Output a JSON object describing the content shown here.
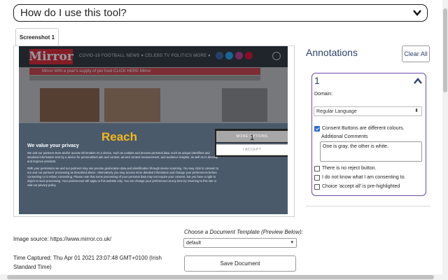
{
  "help": {
    "title": "How do I use this tool?",
    "icon": "chevron-down-icon"
  },
  "tabs": [
    {
      "label": "Screenshot 1"
    }
  ],
  "screenshot": {
    "site_logo": "Mirror",
    "nav": "COVID-19   FOOTBALL   NEWS ▾   CELEBS   TV   POLITICS   MORE ▾",
    "ad_text": "Mirror   WIN a year's supply of pet food   CLICK HERE   Mirror",
    "consent": {
      "brand": "Reach",
      "heading": "We value your privacy",
      "body_1": "We and our partners store and/or access information on a device, such as cookies and process personal data, such as unique identifiers and standard information sent by a device for personalised ads and content, ad and content measurement, and audience insights, as well as to develop and improve products.",
      "body_2": "With your permission we and our partners may use precise geolocation data and identification through device scanning. You may click to consent to our and our partners' processing as described above. Alternatively you may access more detailed information and change your preferences before consenting or to refuse consenting. Please note that some processing of your personal data may not require your consent, but you have a right to object to such processing. Your preferences will apply to this website only. You can change your preferences at any time by returning to this site or visit our privacy policy.",
      "more_options": "MORE OPTIONS",
      "accept": "I ACCEPT",
      "marker": "1"
    },
    "colors": {
      "mirror_red": "#e11b22",
      "reach_yellow": "#f4b71f",
      "consent_bg": "#4a5a6b"
    }
  },
  "annotations": {
    "title": "Annotations",
    "clear_label": "Clear All",
    "items": [
      {
        "number": "1",
        "domain_label": "Domain:",
        "domain_value": "Regular Language",
        "options": [
          {
            "label": "Consent Buttons are different colours.",
            "checked": true
          },
          {
            "label": "There is no reject button.",
            "checked": false
          },
          {
            "label": "I do not know what I am consenting to.",
            "checked": false
          },
          {
            "label": "Choice 'accept all' is pre-highlighted",
            "checked": false
          }
        ],
        "comments_label": "Additional Comments",
        "comment": "One is gray, the other is white."
      }
    ]
  },
  "footer": {
    "source": "Image source: https://www.mirror.co.uk/",
    "time": "Time Captured: Thu Apr 01 2021 23:07:48 GMT+0100 (Irish Standard Time)",
    "template_label": "Choose a Document Template (Preview Below):",
    "template_value": "default",
    "save_label": "Save Document"
  }
}
